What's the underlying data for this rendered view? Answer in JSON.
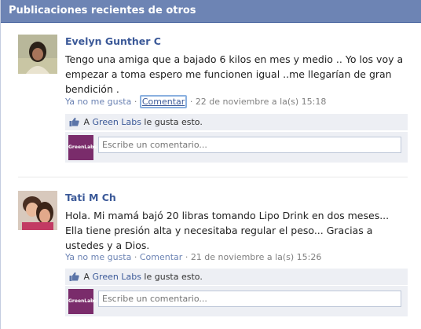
{
  "header": {
    "title": "Publicaciones recientes de otros"
  },
  "posts": [
    {
      "author": "Evelyn Gunther C",
      "text": "Tengo una amiga que a bajado 6 kilos en mes y medio .. Yo los voy a empezar a toma espero me funcionen igual ..me llegarían de gran bendición .",
      "unlike": "Ya no me gusta",
      "comment": "Comentar",
      "timestamp": "22 de noviembre a la(s) 15:18",
      "like_prefix": "A",
      "like_page": "Green Labs",
      "like_suffix": "le gusta esto.",
      "comment_placeholder": "Escribe un comentario...",
      "logo_text": "GreenLabs"
    },
    {
      "author": "Tati M Ch",
      "text": "Hola. Mi mamá bajó 20 libras tomando Lipo Drink en dos meses... Ella tiene presión alta y necesitaba regular el peso... Gracias a ustedes y a Dios.",
      "unlike": "Ya no me gusta",
      "comment": "Comentar",
      "timestamp": "21 de noviembre a la(s) 15:26",
      "like_prefix": "A",
      "like_page": "Green Labs",
      "like_suffix": "le gusta esto.",
      "comment_placeholder": "Escribe un comentario...",
      "logo_text": "GreenLabs"
    }
  ],
  "icons": {
    "like": "thumbs-up-icon",
    "avatar1": "woman-photo",
    "avatar2": "child-photo"
  },
  "colors": {
    "header_bg": "#6d84b4",
    "link": "#3b5998",
    "brand_logo": "#7a2c6b"
  }
}
